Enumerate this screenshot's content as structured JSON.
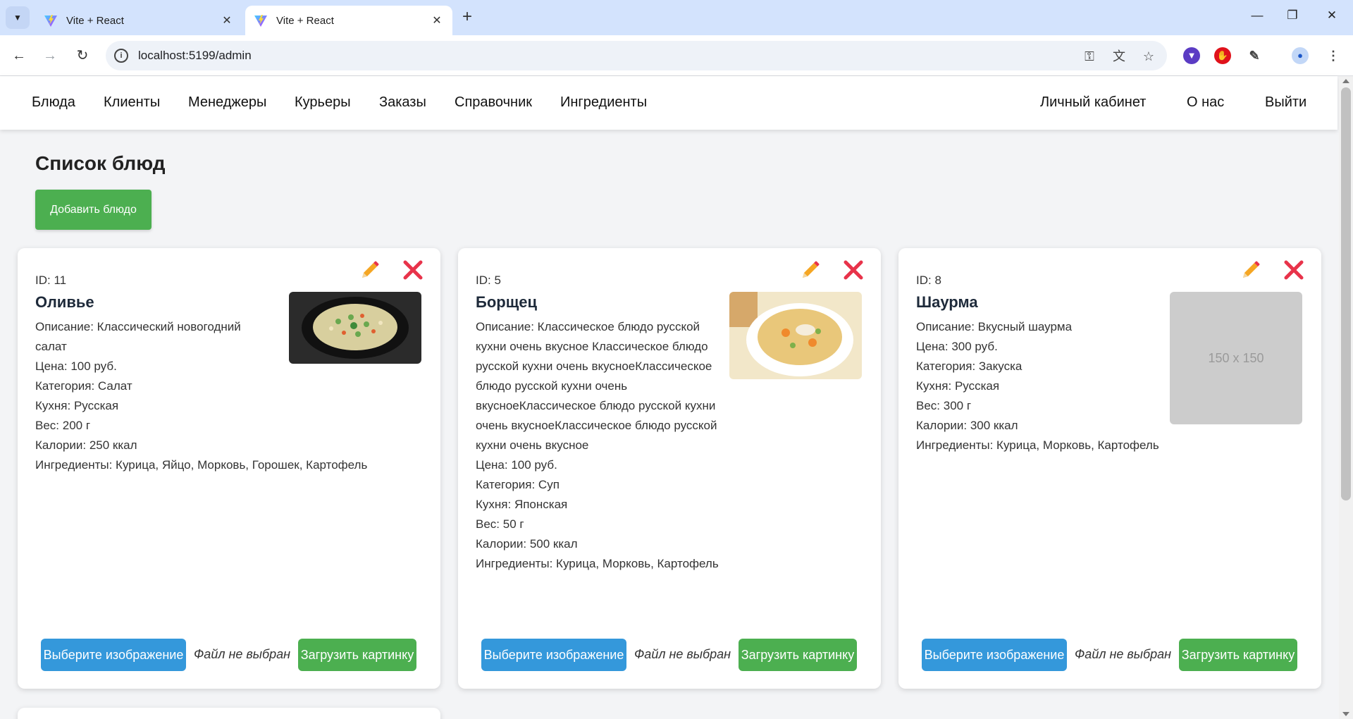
{
  "browser": {
    "tabs": [
      {
        "title": "Vite + React"
      },
      {
        "title": "Vite + React"
      }
    ],
    "url": "localhost:5199/admin"
  },
  "nav": {
    "left": [
      "Блюда",
      "Клиенты",
      "Менеджеры",
      "Курьеры",
      "Заказы",
      "Справочник",
      "Ингредиенты"
    ],
    "right": [
      "Личный кабинет",
      "О нас",
      "Выйти"
    ]
  },
  "page": {
    "title": "Список блюд",
    "add_button": "Добавить блюдо"
  },
  "upload": {
    "choose_label": "Выберите изображение",
    "no_file": "Файл не выбран",
    "upload_label": "Загрузить картинку"
  },
  "dishes": [
    {
      "id": "ID: 11",
      "name": "Оливье",
      "description": "Описание: Классический новогодний салат",
      "price": "Цена: 100 руб.",
      "category": "Категория: Салат",
      "cuisine": "Кухня: Русская",
      "weight": "Вес: 200 г",
      "calories": "Калории: 250 ккал",
      "ingredients": "Ингредиенты: Курица, Яйцо, Морковь, Горошек, Картофель",
      "image": "olivier-salad-photo"
    },
    {
      "id": "ID: 5",
      "name": "Борщец",
      "description": "Описание: Классическое блюдо русской кухни очень вкусное Классическое блюдо русской кухни очень вкусноеКлассическое блюдо русской кухни очень вкусноеКлассическое блюдо русской кухни очень вкусноеКлассическое блюдо русской кухни очень вкусное",
      "price": "Цена: 100 руб.",
      "category": "Категория: Суп",
      "cuisine": "Кухня: Японская",
      "weight": "Вес: 50 г",
      "calories": "Калории: 500 ккал",
      "ingredients": "Ингредиенты: Курица, Морковь, Картофель",
      "image": "soup-photo"
    },
    {
      "id": "ID: 8",
      "name": "Шаурма",
      "description": "Описание: Вкусный шаурма",
      "price": "Цена: 300 руб.",
      "category": "Категория: Закуска",
      "cuisine": "Кухня: Русская",
      "weight": "Вес: 300 г",
      "calories": "Калории: 300 ккал",
      "ingredients": "Ингредиенты: Курица, Морковь, Картофель",
      "image_placeholder": "150 x 150"
    }
  ],
  "colors": {
    "green": "#4caf50",
    "blue": "#3498db",
    "edit": "#f28c28",
    "delete": "#e8334a"
  }
}
